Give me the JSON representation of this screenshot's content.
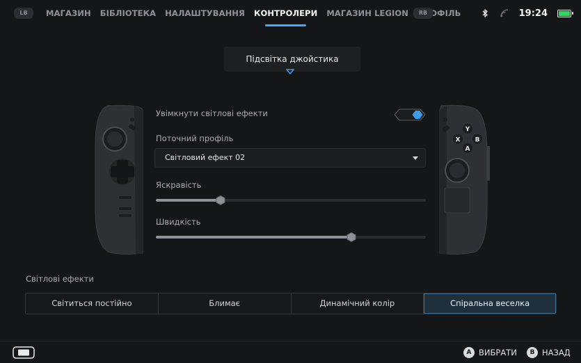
{
  "topbar": {
    "lb": "LB",
    "rb": "RB",
    "nav": [
      {
        "label": "МАГАЗИН"
      },
      {
        "label": "БІБЛІОТЕКА"
      },
      {
        "label": "НАЛАШТУВАННЯ"
      },
      {
        "label": "КОНТРОЛЕРИ",
        "active": true
      },
      {
        "label": "МАГАЗИН LEGION"
      },
      {
        "label": "ПРОФІЛЬ"
      }
    ],
    "time": "19:24",
    "accent_color": "#4aa6ff"
  },
  "section": {
    "title": "Підсвітка джойстика"
  },
  "settings": {
    "lights_toggle": {
      "label": "Увімкнути світлові ефекти",
      "on": true,
      "color": "#3f9be6"
    },
    "profile": {
      "label": "Поточний профіль",
      "value": "Світловий ефект 02"
    },
    "brightness": {
      "label": "Яскравість",
      "level": 0.24
    },
    "speed": {
      "label": "Швидкість",
      "level": 0.725
    }
  },
  "controller": {
    "face_buttons": [
      "Y",
      "X",
      "B",
      "A"
    ]
  },
  "effects": {
    "title": "Світлові ефекти",
    "options": [
      {
        "label": "Світиться постійно"
      },
      {
        "label": "Блимає"
      },
      {
        "label": "Динамічний колір"
      },
      {
        "label": "Спіральна веселка",
        "active": true
      }
    ]
  },
  "bottombar": {
    "select": {
      "button": "A",
      "label": "ВИБРАТИ"
    },
    "back": {
      "button": "B",
      "label": "НАЗАД"
    }
  },
  "icons": [
    "bluetooth-icon",
    "wifi-icon",
    "battery-icon",
    "device-icon",
    "chevron-down-icon"
  ]
}
